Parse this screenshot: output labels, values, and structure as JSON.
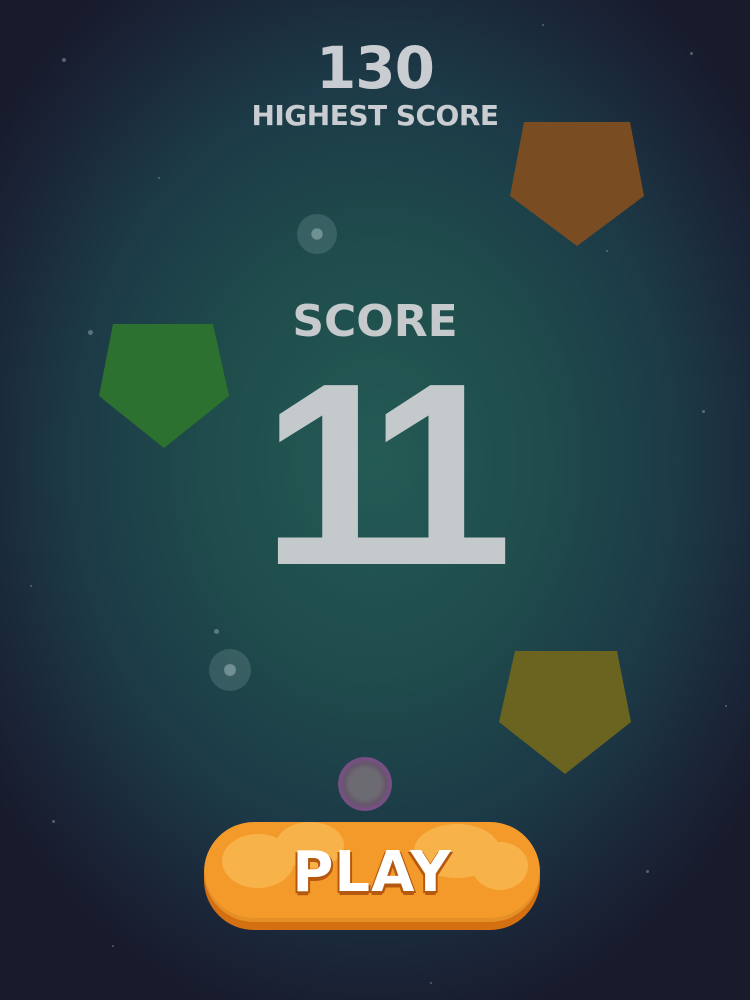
{
  "high_score": {
    "value": "130",
    "label": "HIGHEST SCORE"
  },
  "score": {
    "label": "SCORE",
    "value": "11"
  },
  "play_button": {
    "label": "PLAY"
  },
  "shapes": [
    {
      "name": "orange-pentagon",
      "color": "#7a4c22"
    },
    {
      "name": "green-pentagon",
      "color": "#2d7130"
    },
    {
      "name": "olive-pentagon",
      "color": "#6b6421"
    }
  ],
  "colors": {
    "play_button": "#f39a2a",
    "text": "#c6cacd"
  }
}
